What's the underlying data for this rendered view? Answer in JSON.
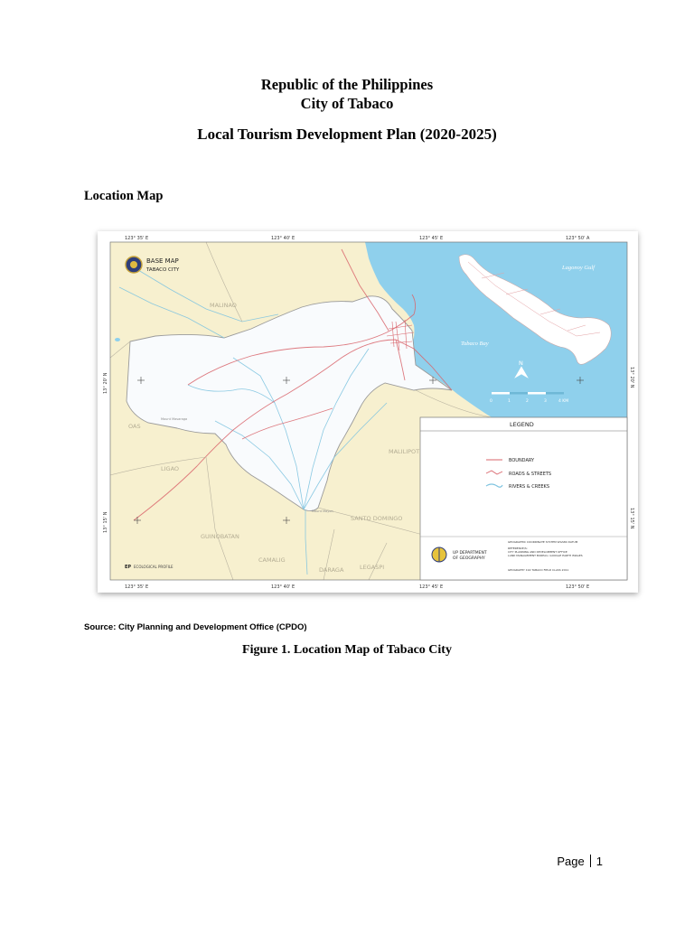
{
  "document": {
    "header_line1": "Republic of the Philippines",
    "header_line2": "City of Tabaco",
    "title": "Local Tourism Development Plan (2020-2025)",
    "section_heading": "Location Map",
    "source_note": "Source: City Planning and Development Office (CPDO)",
    "figure_caption": "Figure 1. Location Map of Tabaco City",
    "page_label": "Page",
    "page_number": "1"
  },
  "map": {
    "title_main": "BASE MAP",
    "title_sub": "TABACO CITY",
    "top_ticks": [
      "123° 35' E",
      "123° 40' E",
      "123° 45' E",
      "123° 50' A"
    ],
    "bottom_ticks": [
      "123° 35' E",
      "123° 40' E",
      "123° 45' E",
      "123° 50' E"
    ],
    "left_ticks": [
      "13° 20' N",
      "13° 15' N"
    ],
    "right_ticks": [
      "13° 20' N",
      "13° 15' N"
    ],
    "places": {
      "malinao": "MALINAO",
      "oas": "OAS",
      "ligao": "LIGAO",
      "malilipot": "MALILIPOT",
      "santo_domingo": "SANTO DOMINGO",
      "guinobatan": "GUINOBATAN",
      "camalig": "CAMALIG",
      "daraga": "DARAGA",
      "legaspi": "LEGASPI",
      "lagonoy_gulf": "Lagonoy Gulf",
      "tabaco_bay": "Tabaco Bay",
      "mount_masaraga": "Mount Masaraga",
      "mount_mayon": "Mount Mayon"
    },
    "north_label": "N",
    "scale_labels": [
      "0",
      "1",
      "2",
      "3",
      "4 KM"
    ],
    "legend_title": "LEGEND",
    "legend_items": [
      "BOUNDARY",
      "ROADS & STREETS",
      "RIVERS & CREEKS"
    ],
    "dept_line1": "UP DEPARTMENT",
    "dept_line2": "OF GEOGRAPHY",
    "notes": [
      "GEOGRAPHIC COORDINATE SYSTEM WGS84 DATUM",
      "REFERENCE/S:",
      "CITY PLANNING AND DEVELOPMENT OFFICE",
      "LAND MANAGEMENT BUREAU, GOOGLE EARTH IMAGES",
      "GEOGRAPHY 192 TABACO FIELD CLASS 2011"
    ],
    "profile_code": "EP",
    "profile_text": "ECOLOGICAL PROFILE",
    "colors": {
      "land": "#f7f0cf",
      "city": "#f9fbfd",
      "water": "#8fd0ec",
      "road": "#d9646b",
      "river": "#7fc4e0",
      "boundary": "#9a9a9a"
    }
  }
}
